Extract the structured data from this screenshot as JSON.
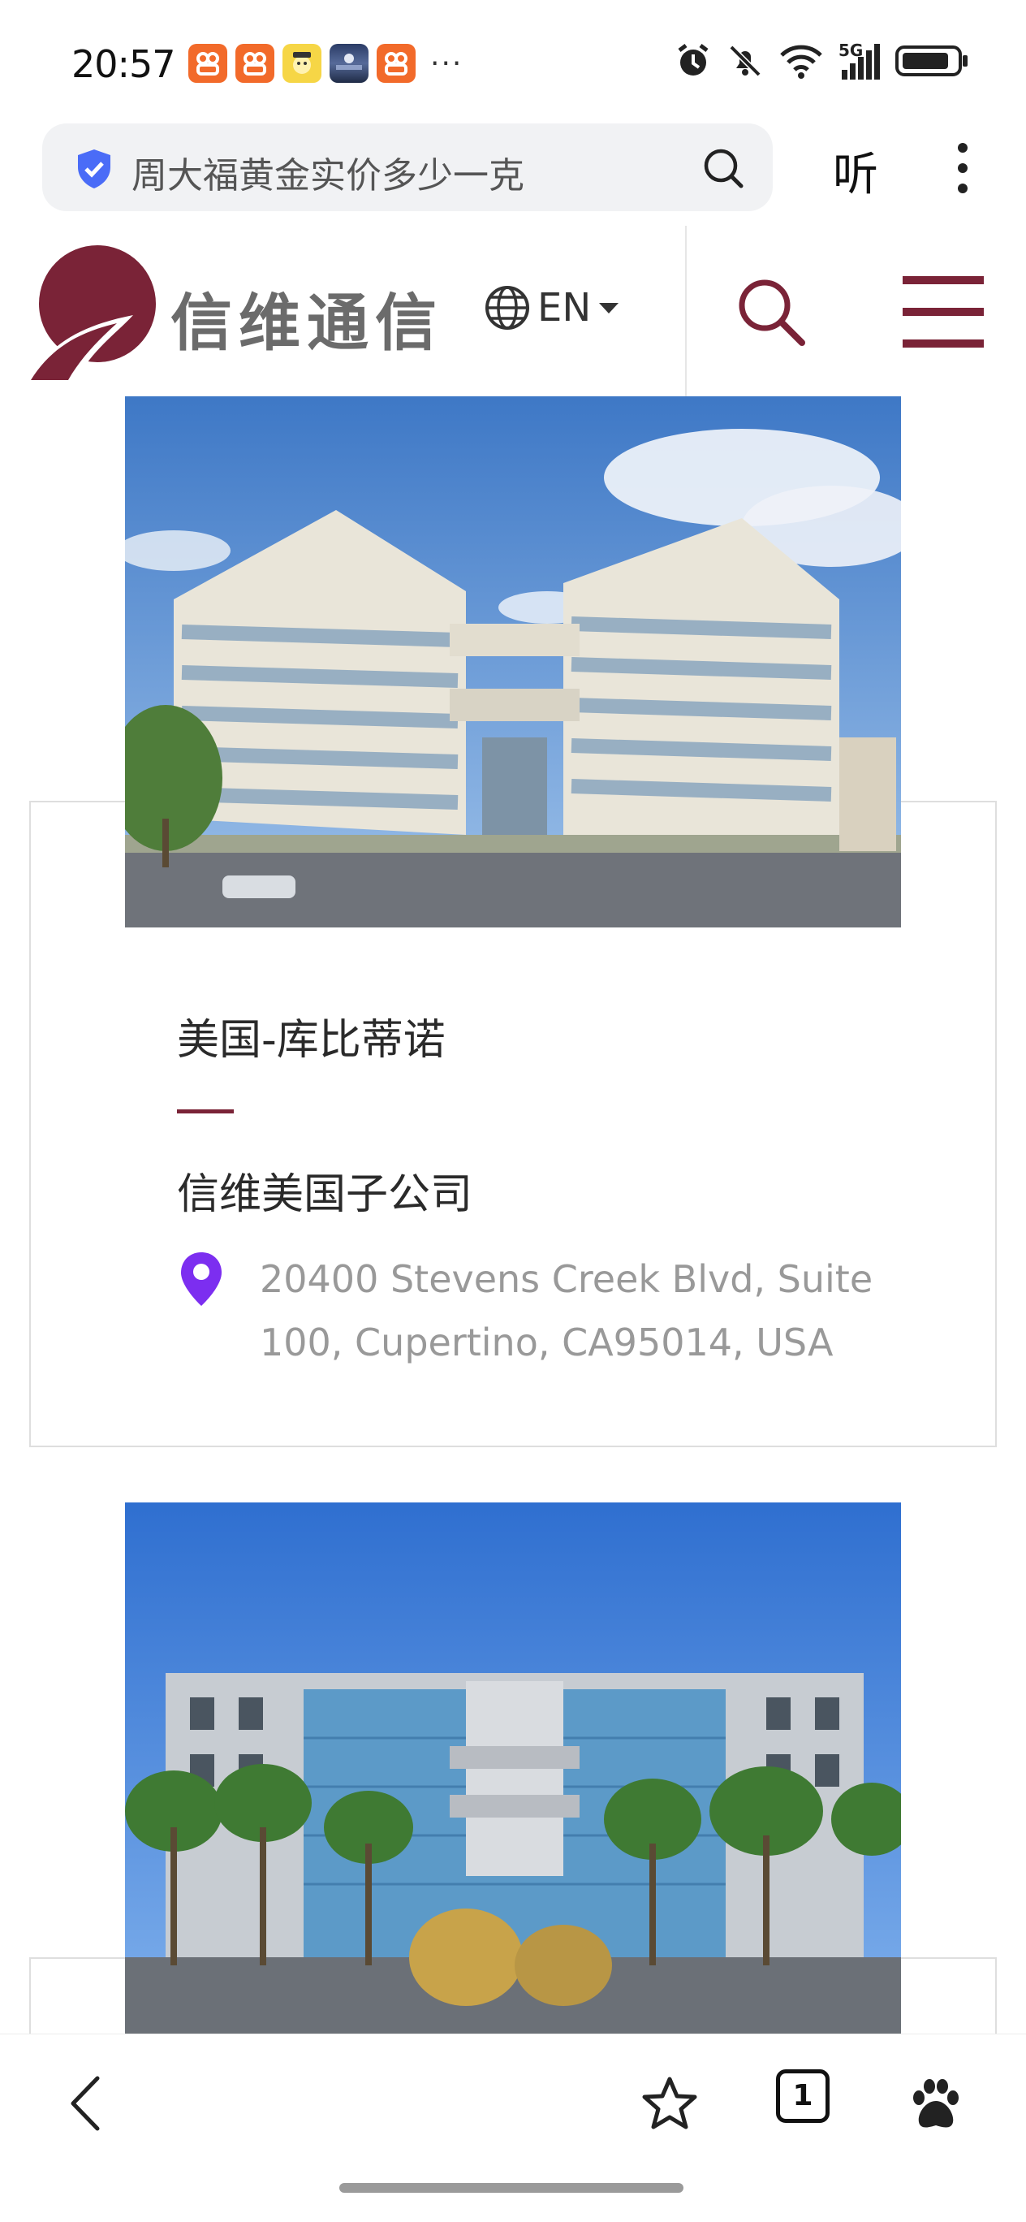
{
  "status_bar": {
    "time": "20:57",
    "notification_icons": [
      "app-icon-orange",
      "app-icon-orange",
      "app-icon-yellow",
      "app-icon-photo",
      "app-icon-orange"
    ],
    "overflow": "···",
    "network_label": "5G",
    "status_icons": [
      "alarm-icon",
      "mute-icon",
      "wifi-icon",
      "cellular-signal-icon",
      "battery-icon"
    ]
  },
  "browser": {
    "search_text": "周大福黄金实价多少一克",
    "listen_label": "听",
    "tab_count": "1",
    "bottom_icons": [
      "back-arrow-icon",
      "star-icon",
      "tabs-icon",
      "paw-icon"
    ]
  },
  "site": {
    "logo_text": "信维通信",
    "language": "EN",
    "brand_color": "#7a2337"
  },
  "offices": [
    {
      "city": "美国-库比蒂诺",
      "company": "信维美国子公司",
      "address": "20400 Stevens Creek Blvd, Suite 100, Cupertino, CA95014, USA"
    }
  ]
}
